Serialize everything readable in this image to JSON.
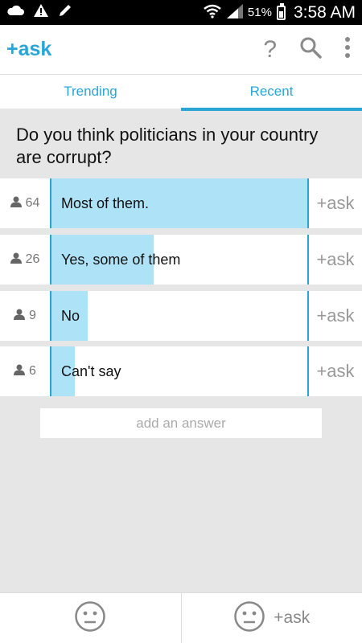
{
  "status_bar": {
    "battery": "51%",
    "time": "3:58 AM",
    "icons": [
      "cloud-icon",
      "warning-icon",
      "edit-icon",
      "wifi-icon",
      "signal-icon",
      "battery-icon"
    ]
  },
  "app_bar": {
    "logo": "+ask",
    "actions": [
      "help-icon",
      "search-icon",
      "more-icon"
    ]
  },
  "tabs": [
    {
      "label": "Trending",
      "active": false
    },
    {
      "label": "Recent",
      "active": true
    }
  ],
  "question": "Do you think politicians in your country are corrupt?",
  "answers": [
    {
      "votes": "64",
      "text": "Most of them.",
      "fill": 1.0,
      "ask": "+ask"
    },
    {
      "votes": "26",
      "text": "Yes, some of them",
      "fill": 0.4,
      "ask": "+ask"
    },
    {
      "votes": "9",
      "text": "No",
      "fill": 0.14,
      "ask": "+ask"
    },
    {
      "votes": "6",
      "text": "Can't say",
      "fill": 0.09,
      "ask": "+ask"
    }
  ],
  "add_answer_placeholder": "add an answer",
  "bottom_bar": {
    "right_label": "+ask"
  },
  "colors": {
    "accent": "#2aa6d6",
    "fill": "#aee3f7",
    "background": "#e6e6e6"
  }
}
